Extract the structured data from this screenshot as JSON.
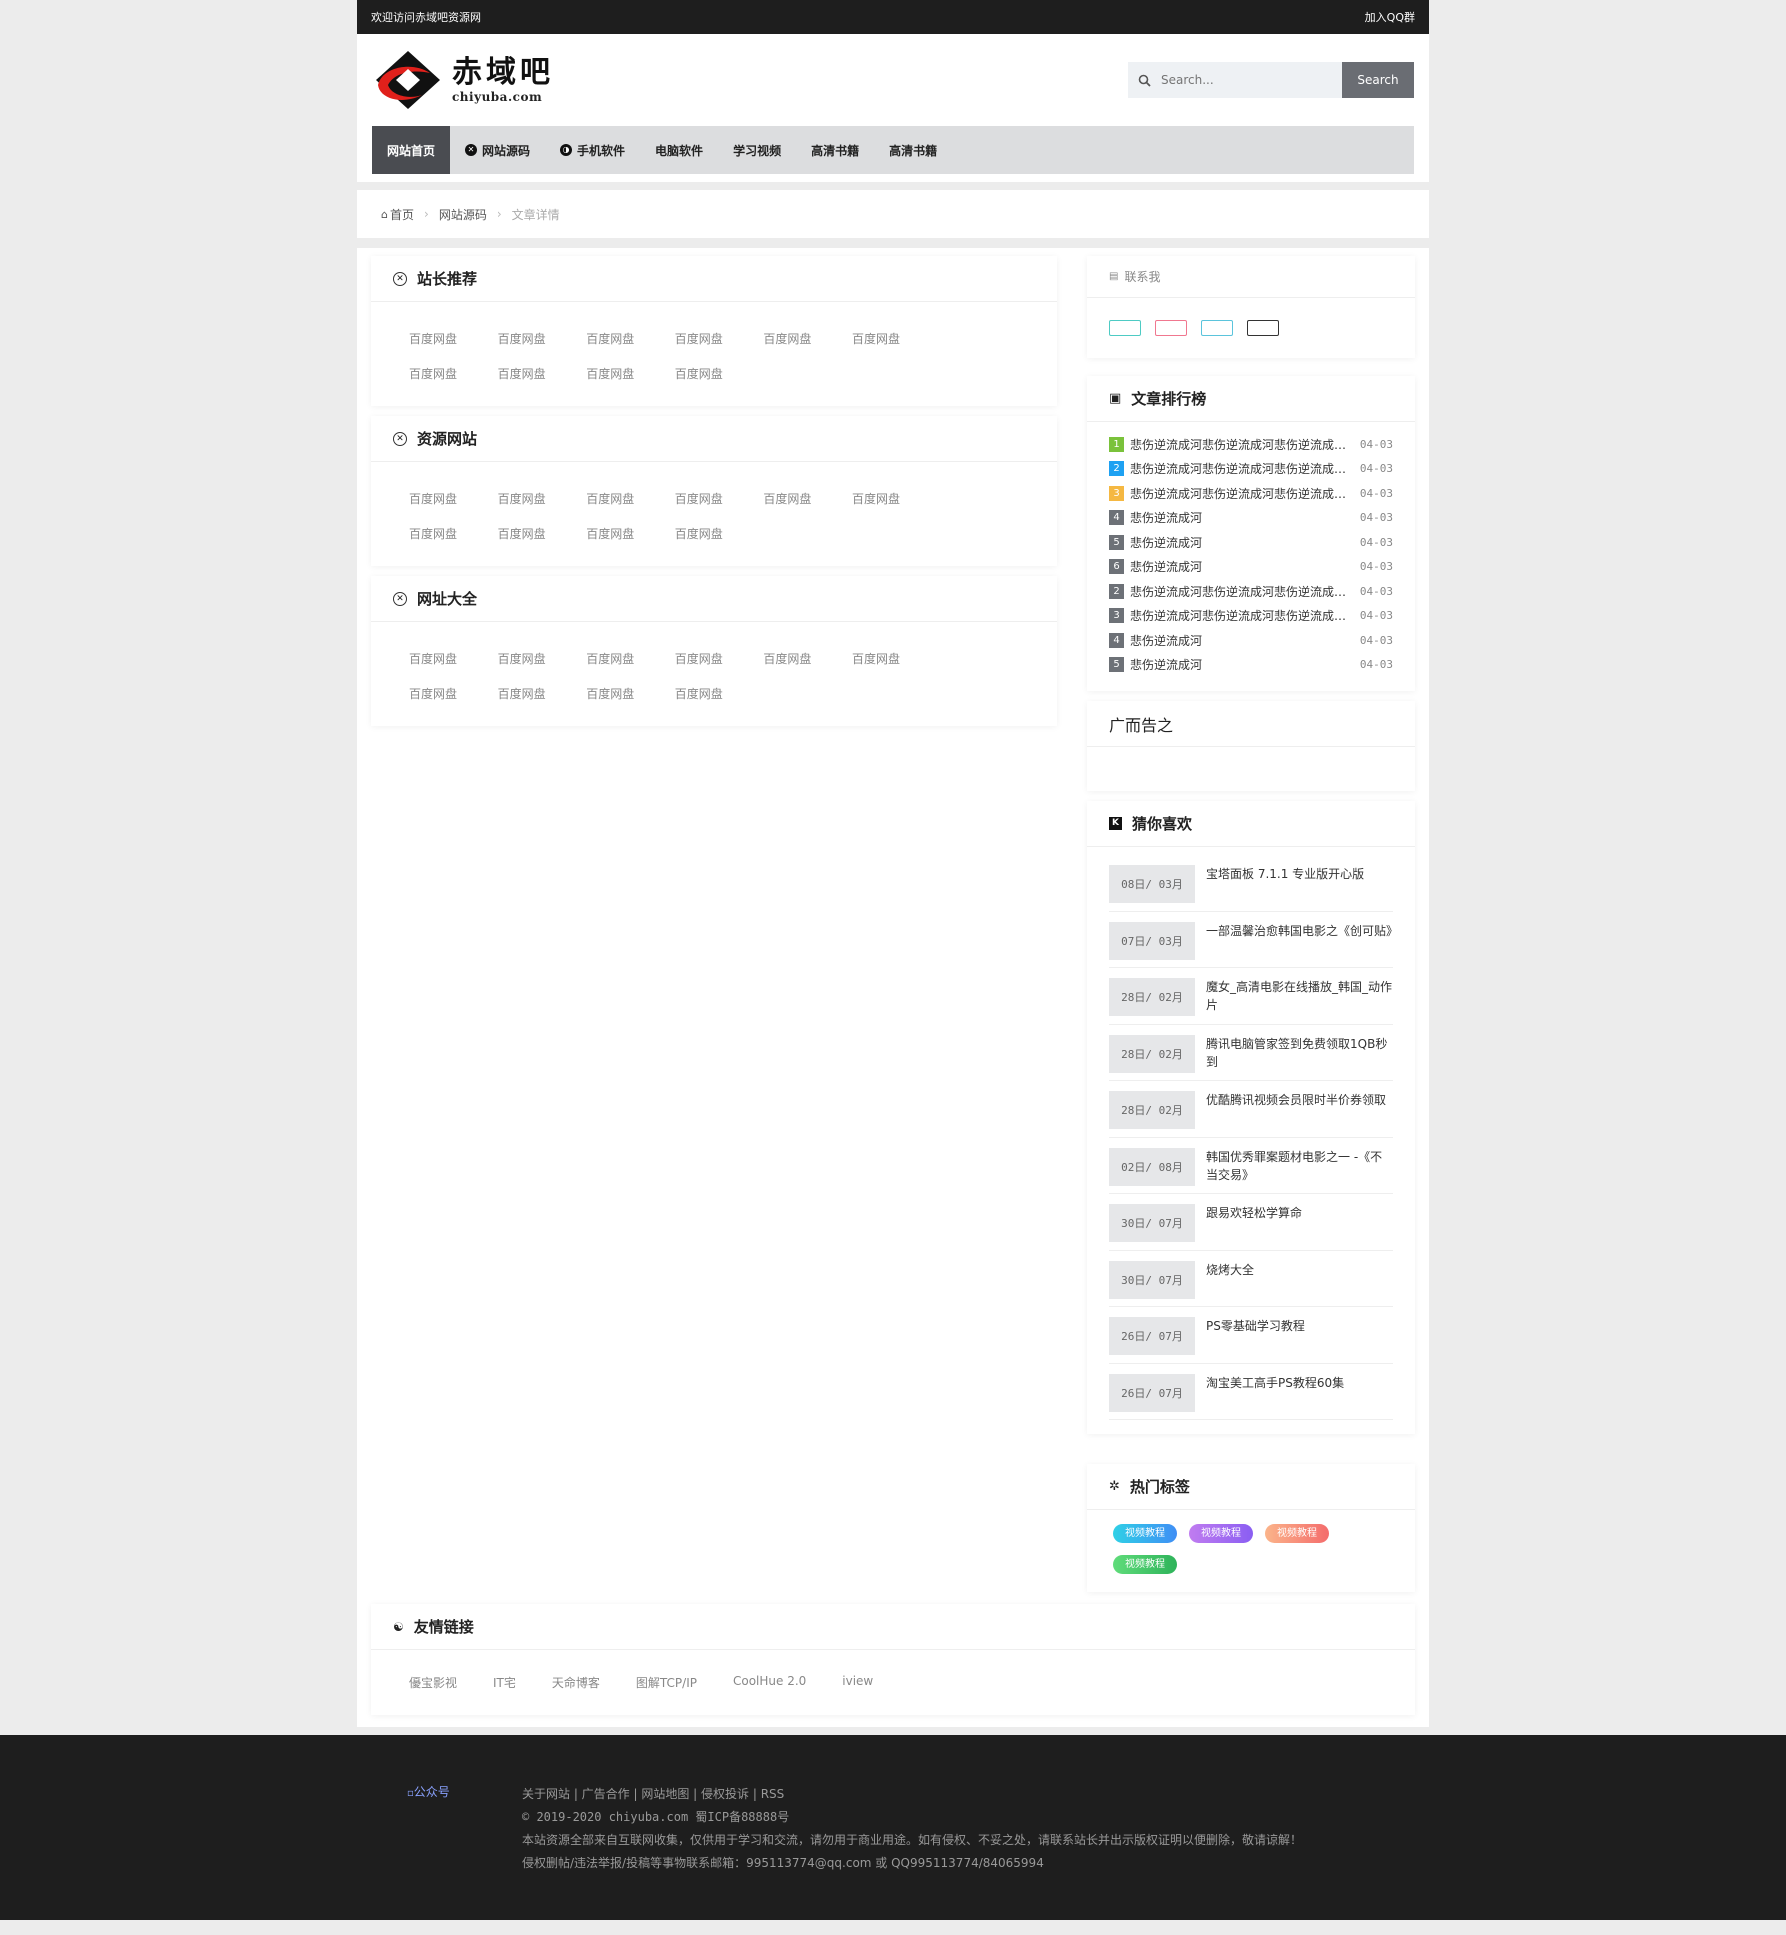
{
  "topbar": {
    "welcome": "欢迎访问赤域吧资源网",
    "join_qq": "加入QQ群"
  },
  "header": {
    "logo_cn": "赤域吧",
    "logo_en": "chiyuba.com",
    "search_placeholder": "Search...",
    "search_button": "Search"
  },
  "nav": {
    "items": [
      {
        "label": "网站首页",
        "icon": ""
      },
      {
        "label": "网站源码",
        "icon": "x-circle-icon"
      },
      {
        "label": "手机软件",
        "icon": "yin-yang-icon"
      },
      {
        "label": "电脑软件",
        "icon": ""
      },
      {
        "label": "学习视频",
        "icon": ""
      },
      {
        "label": "高清书籍",
        "icon": ""
      },
      {
        "label": "高清书籍",
        "icon": ""
      }
    ]
  },
  "breadcrumb": {
    "home": "首页",
    "category": "网站源码",
    "current": "文章详情"
  },
  "sections": [
    {
      "title": "站长推荐",
      "links": [
        "百度网盘",
        "百度网盘",
        "百度网盘",
        "百度网盘",
        "百度网盘",
        "百度网盘",
        "百度网盘",
        "百度网盘",
        "百度网盘",
        "百度网盘"
      ]
    },
    {
      "title": "资源网站",
      "links": [
        "百度网盘",
        "百度网盘",
        "百度网盘",
        "百度网盘",
        "百度网盘",
        "百度网盘",
        "百度网盘",
        "百度网盘",
        "百度网盘",
        "百度网盘"
      ]
    },
    {
      "title": "网址大全",
      "links": [
        "百度网盘",
        "百度网盘",
        "百度网盘",
        "百度网盘",
        "百度网盘",
        "百度网盘",
        "百度网盘",
        "百度网盘",
        "百度网盘",
        "百度网盘"
      ]
    }
  ],
  "sidebar": {
    "contact": {
      "title": "联系我",
      "buttons": [
        "#4ecbc4",
        "#f0778f",
        "#5bc4dc",
        "#333333"
      ]
    },
    "rank": {
      "title": "文章排行榜",
      "rows": [
        {
          "num": "1",
          "color": "#7ac23b",
          "title": "悲伤逆流成河悲伤逆流成河悲伤逆流成河悲伤逆流成河",
          "date": "04-03"
        },
        {
          "num": "2",
          "color": "#1ea1f2",
          "title": "悲伤逆流成河悲伤逆流成河悲伤逆流成河悲伤逆流成河",
          "date": "04-03"
        },
        {
          "num": "3",
          "color": "#f5b842",
          "title": "悲伤逆流成河悲伤逆流成河悲伤逆流成河悲伤逆流成河",
          "date": "04-03"
        },
        {
          "num": "4",
          "color": "#6d7177",
          "title": "悲伤逆流成河",
          "date": "04-03"
        },
        {
          "num": "5",
          "color": "#6d7177",
          "title": "悲伤逆流成河",
          "date": "04-03"
        },
        {
          "num": "6",
          "color": "#6d7177",
          "title": "悲伤逆流成河",
          "date": "04-03"
        },
        {
          "num": "2",
          "color": "#6d7177",
          "title": "悲伤逆流成河悲伤逆流成河悲伤逆流成河悲伤逆流成河",
          "date": "04-03"
        },
        {
          "num": "3",
          "color": "#6d7177",
          "title": "悲伤逆流成河悲伤逆流成河悲伤逆流成河悲伤逆流成河",
          "date": "04-03"
        },
        {
          "num": "4",
          "color": "#6d7177",
          "title": "悲伤逆流成河",
          "date": "04-03"
        },
        {
          "num": "5",
          "color": "#6d7177",
          "title": "悲伤逆流成河",
          "date": "04-03"
        }
      ]
    },
    "ad": {
      "title": "广而告之"
    },
    "guess": {
      "title": "猜你喜欢",
      "items": [
        {
          "date": "08日/ 03月",
          "title": "宝塔面板 7.1.1 专业版开心版"
        },
        {
          "date": "07日/ 03月",
          "title": "一部温馨治愈韩国电影之《创可贴》"
        },
        {
          "date": "28日/ 02月",
          "title": "魔女_高清电影在线播放_韩国_动作片"
        },
        {
          "date": "28日/ 02月",
          "title": "腾讯电脑管家签到免费领取1QB秒到"
        },
        {
          "date": "28日/ 02月",
          "title": "优酷腾讯视频会员限时半价券领取"
        },
        {
          "date": "02日/ 08月",
          "title": "韩国优秀罪案题材电影之一 -《不当交易》"
        },
        {
          "date": "30日/ 07月",
          "title": "跟易欢轻松学算命"
        },
        {
          "date": "30日/ 07月",
          "title": "烧烤大全"
        },
        {
          "date": "26日/ 07月",
          "title": "PS零基础学习教程"
        },
        {
          "date": "26日/ 07月",
          "title": "淘宝美工高手PS教程60集"
        }
      ]
    },
    "tags": {
      "title": "热门标签",
      "items": [
        {
          "label": "视频教程",
          "color": "linear-gradient(90deg,#2fd0e6,#3f8ef5)"
        },
        {
          "label": "视频教程",
          "color": "linear-gradient(90deg,#c07cf0,#8a5ef2)"
        },
        {
          "label": "视频教程",
          "color": "linear-gradient(90deg,#fbb48a,#f46c6c)"
        },
        {
          "label": "视频教程",
          "color": "linear-gradient(90deg,#5fdc7a,#2eb35a)"
        }
      ]
    }
  },
  "friends": {
    "title": "友情链接",
    "links": [
      "優宝影视",
      "IT宅",
      "天命博客",
      "图解TCP/IP",
      "CoolHue 2.0",
      "iview"
    ]
  },
  "footer": {
    "qr_alt": "公众号",
    "links_line": "关于网站 | 广告合作 | 网站地图 | 侵权投诉 | RSS",
    "copyright": "© 2019-2020 chiyuba.com 蜀ICP备88888号",
    "disclaimer": "本站资源全部来自互联网收集，仅供用于学习和交流，请勿用于商业用途。如有侵权、不妥之处，请联系站长并出示版权证明以便删除，敬请谅解！",
    "contact": "侵权删帖/违法举报/投稿等事物联系邮箱：995113774@qq.com 或 QQ995113774/84065994"
  }
}
